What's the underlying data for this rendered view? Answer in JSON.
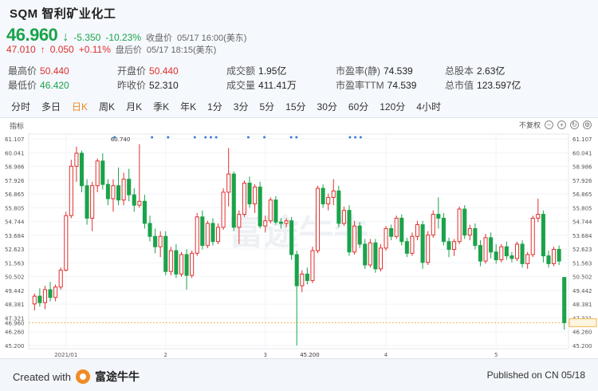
{
  "header": {
    "title": "SQM 智利矿业化工",
    "price": "46.960",
    "change": "-5.350",
    "change_pct": "-10.23%",
    "close_label": "收盘价",
    "close_time": "05/17 16:00(美东)",
    "ah_price": "47.010",
    "ah_change": "0.050",
    "ah_change_pct": "+0.11%",
    "ah_label": "盘后价",
    "ah_time": "05/17 18:15(美东)"
  },
  "stats": [
    [
      {
        "label": "最高价",
        "value": "50.440",
        "color": "red"
      },
      {
        "label": "开盘价",
        "value": "50.440",
        "color": "red"
      },
      {
        "label": "成交额",
        "value": "1.95亿",
        "color": "dark"
      },
      {
        "label": "市盈率(静)",
        "value": "74.539",
        "color": "dark"
      },
      {
        "label": "总股本",
        "value": "2.63亿",
        "color": "dark"
      }
    ],
    [
      {
        "label": "最低价",
        "value": "46.420",
        "color": "green"
      },
      {
        "label": "昨收价",
        "value": "52.310",
        "color": "dark"
      },
      {
        "label": "成交量",
        "value": "411.41万",
        "color": "dark"
      },
      {
        "label": "市盈率TTM",
        "value": "74.539",
        "color": "dark"
      },
      {
        "label": "总市值",
        "value": "123.597亿",
        "color": "dark"
      }
    ]
  ],
  "tabs": [
    "分时",
    "多日",
    "日K",
    "周K",
    "月K",
    "季K",
    "年K",
    "1分",
    "3分",
    "5分",
    "15分",
    "30分",
    "60分",
    "120分",
    "4小时"
  ],
  "active_tab": 2,
  "toolbar": {
    "indicator_label": "指标",
    "adjust_label": "不复权"
  },
  "watermark": "富途牛牛",
  "footer": {
    "created_with": "Created with",
    "brand": "富途牛牛",
    "published": "Published on CN 05/18"
  },
  "colors": {
    "up": "#e0302e",
    "down": "#1aa34a",
    "accent": "#f08a24"
  },
  "chart_data": {
    "type": "candlestick",
    "y_ticks": [
      "61.107",
      "60.041",
      "58.986",
      "57.926",
      "56.865",
      "55.805",
      "54.744",
      "53.684",
      "52.623",
      "51.563",
      "50.502",
      "49.442",
      "48.381",
      "47.321",
      "46.960",
      "46.260",
      "45.200"
    ],
    "ylim": [
      45.2,
      61.107
    ],
    "x_labels": [
      {
        "i": 6,
        "label": "2021/01"
      },
      {
        "i": 25,
        "label": "2"
      },
      {
        "i": 44,
        "label": "3"
      },
      {
        "i": 67,
        "label": "4"
      },
      {
        "i": 88,
        "label": "5"
      }
    ],
    "last_price": 46.96,
    "annotations": [
      {
        "i": 20,
        "value": 60.74,
        "label": "60.740"
      },
      {
        "i": 50,
        "value": 45.2,
        "label": "45.200"
      }
    ],
    "candles": [
      {
        "o": 48.4,
        "h": 49.2,
        "l": 47.9,
        "c": 49.0
      },
      {
        "o": 49.0,
        "h": 49.6,
        "l": 48.2,
        "c": 48.5
      },
      {
        "o": 48.5,
        "h": 49.8,
        "l": 48.0,
        "c": 49.5
      },
      {
        "o": 49.5,
        "h": 50.1,
        "l": 48.6,
        "c": 48.9
      },
      {
        "o": 48.9,
        "h": 49.9,
        "l": 48.6,
        "c": 49.7
      },
      {
        "o": 49.7,
        "h": 51.2,
        "l": 49.5,
        "c": 51.0
      },
      {
        "o": 51.0,
        "h": 55.5,
        "l": 50.9,
        "c": 55.2
      },
      {
        "o": 55.2,
        "h": 59.5,
        "l": 55.0,
        "c": 59.0
      },
      {
        "o": 59.0,
        "h": 60.5,
        "l": 57.8,
        "c": 60.0
      },
      {
        "o": 60.0,
        "h": 60.2,
        "l": 57.0,
        "c": 57.5
      },
      {
        "o": 57.5,
        "h": 58.0,
        "l": 54.5,
        "c": 55.0
      },
      {
        "o": 55.0,
        "h": 57.8,
        "l": 54.0,
        "c": 57.5
      },
      {
        "o": 57.5,
        "h": 59.6,
        "l": 57.0,
        "c": 59.4
      },
      {
        "o": 59.4,
        "h": 60.0,
        "l": 57.2,
        "c": 57.6
      },
      {
        "o": 57.6,
        "h": 58.0,
        "l": 56.0,
        "c": 56.5
      },
      {
        "o": 56.5,
        "h": 58.0,
        "l": 55.5,
        "c": 57.5
      },
      {
        "o": 57.5,
        "h": 58.9,
        "l": 56.0,
        "c": 56.4
      },
      {
        "o": 56.4,
        "h": 58.5,
        "l": 56.0,
        "c": 58.0
      },
      {
        "o": 58.0,
        "h": 58.8,
        "l": 56.3,
        "c": 56.8
      },
      {
        "o": 56.8,
        "h": 57.3,
        "l": 55.5,
        "c": 56.0
      },
      {
        "o": 56.0,
        "h": 60.7,
        "l": 55.8,
        "c": 56.3
      },
      {
        "o": 56.3,
        "h": 56.8,
        "l": 54.2,
        "c": 54.6
      },
      {
        "o": 54.6,
        "h": 55.2,
        "l": 53.2,
        "c": 53.6
      },
      {
        "o": 53.6,
        "h": 54.2,
        "l": 52.3,
        "c": 52.8
      },
      {
        "o": 52.8,
        "h": 54.0,
        "l": 52.0,
        "c": 53.6
      },
      {
        "o": 53.6,
        "h": 54.0,
        "l": 50.6,
        "c": 50.9
      },
      {
        "o": 50.9,
        "h": 52.8,
        "l": 50.6,
        "c": 52.5
      },
      {
        "o": 52.5,
        "h": 53.0,
        "l": 50.4,
        "c": 50.7
      },
      {
        "o": 50.7,
        "h": 52.4,
        "l": 50.5,
        "c": 52.2
      },
      {
        "o": 52.2,
        "h": 52.6,
        "l": 49.5,
        "c": 50.6
      },
      {
        "o": 50.6,
        "h": 52.5,
        "l": 50.4,
        "c": 52.3
      },
      {
        "o": 52.3,
        "h": 55.4,
        "l": 52.1,
        "c": 55.1
      },
      {
        "o": 55.1,
        "h": 55.6,
        "l": 52.6,
        "c": 52.9
      },
      {
        "o": 52.9,
        "h": 54.8,
        "l": 52.7,
        "c": 54.6
      },
      {
        "o": 54.6,
        "h": 55.0,
        "l": 52.9,
        "c": 53.2
      },
      {
        "o": 53.2,
        "h": 54.6,
        "l": 53.0,
        "c": 54.3
      },
      {
        "o": 54.3,
        "h": 57.3,
        "l": 54.1,
        "c": 57.0
      },
      {
        "o": 57.0,
        "h": 60.4,
        "l": 55.9,
        "c": 58.4
      },
      {
        "o": 58.4,
        "h": 58.6,
        "l": 54.0,
        "c": 54.3
      },
      {
        "o": 54.3,
        "h": 55.6,
        "l": 53.0,
        "c": 55.3
      },
      {
        "o": 55.3,
        "h": 57.9,
        "l": 55.1,
        "c": 57.7
      },
      {
        "o": 57.7,
        "h": 58.2,
        "l": 55.8,
        "c": 56.1
      },
      {
        "o": 56.1,
        "h": 57.6,
        "l": 55.4,
        "c": 57.4
      },
      {
        "o": 57.4,
        "h": 57.8,
        "l": 54.2,
        "c": 54.4
      },
      {
        "o": 54.4,
        "h": 55.2,
        "l": 53.9,
        "c": 54.8
      },
      {
        "o": 54.8,
        "h": 56.6,
        "l": 54.6,
        "c": 56.4
      },
      {
        "o": 56.4,
        "h": 56.7,
        "l": 54.5,
        "c": 54.7
      },
      {
        "o": 54.7,
        "h": 55.0,
        "l": 54.2,
        "c": 54.6
      },
      {
        "o": 54.6,
        "h": 55.0,
        "l": 54.3,
        "c": 54.8
      },
      {
        "o": 54.8,
        "h": 55.1,
        "l": 51.8,
        "c": 52.2
      },
      {
        "o": 52.2,
        "h": 52.5,
        "l": 45.2,
        "c": 49.8
      },
      {
        "o": 49.8,
        "h": 51.0,
        "l": 49.3,
        "c": 50.7
      },
      {
        "o": 50.7,
        "h": 51.2,
        "l": 49.9,
        "c": 50.2
      },
      {
        "o": 50.2,
        "h": 52.8,
        "l": 50.0,
        "c": 52.5
      },
      {
        "o": 52.5,
        "h": 57.5,
        "l": 52.3,
        "c": 57.3
      },
      {
        "o": 57.3,
        "h": 57.6,
        "l": 55.8,
        "c": 56.1
      },
      {
        "o": 56.1,
        "h": 56.9,
        "l": 55.6,
        "c": 56.6
      },
      {
        "o": 56.6,
        "h": 58.0,
        "l": 56.0,
        "c": 57.1
      },
      {
        "o": 57.1,
        "h": 57.5,
        "l": 54.3,
        "c": 54.6
      },
      {
        "o": 54.6,
        "h": 55.9,
        "l": 54.4,
        "c": 55.6
      },
      {
        "o": 55.6,
        "h": 56.0,
        "l": 52.1,
        "c": 52.4
      },
      {
        "o": 52.4,
        "h": 54.8,
        "l": 52.2,
        "c": 54.4
      },
      {
        "o": 54.4,
        "h": 54.7,
        "l": 52.7,
        "c": 53.0
      },
      {
        "o": 53.0,
        "h": 53.4,
        "l": 51.1,
        "c": 51.4
      },
      {
        "o": 51.4,
        "h": 53.4,
        "l": 51.2,
        "c": 53.1
      },
      {
        "o": 53.1,
        "h": 53.4,
        "l": 50.8,
        "c": 51.1
      },
      {
        "o": 51.1,
        "h": 53.0,
        "l": 50.9,
        "c": 52.7
      },
      {
        "o": 52.7,
        "h": 54.4,
        "l": 52.5,
        "c": 54.2
      },
      {
        "o": 54.2,
        "h": 54.5,
        "l": 53.3,
        "c": 53.6
      },
      {
        "o": 53.6,
        "h": 55.2,
        "l": 53.4,
        "c": 55.0
      },
      {
        "o": 55.0,
        "h": 55.3,
        "l": 52.9,
        "c": 53.2
      },
      {
        "o": 53.2,
        "h": 53.5,
        "l": 52.0,
        "c": 52.3
      },
      {
        "o": 52.3,
        "h": 53.9,
        "l": 52.1,
        "c": 53.6
      },
      {
        "o": 53.6,
        "h": 54.8,
        "l": 53.3,
        "c": 54.5
      },
      {
        "o": 54.5,
        "h": 54.8,
        "l": 51.1,
        "c": 51.6
      },
      {
        "o": 51.6,
        "h": 54.0,
        "l": 51.4,
        "c": 53.7
      },
      {
        "o": 53.7,
        "h": 55.6,
        "l": 53.5,
        "c": 55.3
      },
      {
        "o": 55.3,
        "h": 56.6,
        "l": 54.2,
        "c": 55.0
      },
      {
        "o": 55.0,
        "h": 55.4,
        "l": 52.9,
        "c": 53.2
      },
      {
        "o": 53.2,
        "h": 53.5,
        "l": 52.0,
        "c": 52.6
      },
      {
        "o": 52.6,
        "h": 53.4,
        "l": 52.1,
        "c": 53.2
      },
      {
        "o": 53.2,
        "h": 55.9,
        "l": 53.0,
        "c": 55.7
      },
      {
        "o": 55.7,
        "h": 56.0,
        "l": 53.4,
        "c": 53.7
      },
      {
        "o": 53.7,
        "h": 54.5,
        "l": 53.3,
        "c": 54.2
      },
      {
        "o": 54.2,
        "h": 54.6,
        "l": 52.6,
        "c": 52.9
      },
      {
        "o": 52.9,
        "h": 53.3,
        "l": 51.3,
        "c": 51.7
      },
      {
        "o": 51.7,
        "h": 53.8,
        "l": 51.5,
        "c": 53.5
      },
      {
        "o": 53.5,
        "h": 53.9,
        "l": 51.9,
        "c": 52.4
      },
      {
        "o": 52.4,
        "h": 53.0,
        "l": 51.5,
        "c": 51.8
      },
      {
        "o": 51.8,
        "h": 53.0,
        "l": 51.6,
        "c": 52.8
      },
      {
        "o": 52.8,
        "h": 53.2,
        "l": 51.8,
        "c": 52.1
      },
      {
        "o": 52.1,
        "h": 52.4,
        "l": 51.6,
        "c": 51.9
      },
      {
        "o": 51.9,
        "h": 53.2,
        "l": 51.7,
        "c": 53.0
      },
      {
        "o": 53.0,
        "h": 53.3,
        "l": 51.2,
        "c": 51.5
      },
      {
        "o": 51.5,
        "h": 52.4,
        "l": 51.1,
        "c": 52.2
      },
      {
        "o": 52.2,
        "h": 55.2,
        "l": 52.0,
        "c": 55.0
      },
      {
        "o": 55.0,
        "h": 56.5,
        "l": 54.7,
        "c": 55.3
      },
      {
        "o": 55.3,
        "h": 55.6,
        "l": 51.6,
        "c": 52.1
      },
      {
        "o": 52.1,
        "h": 52.5,
        "l": 51.2,
        "c": 51.5
      },
      {
        "o": 51.5,
        "h": 52.8,
        "l": 51.3,
        "c": 52.6
      },
      {
        "o": 52.6,
        "h": 52.9,
        "l": 51.4,
        "c": 51.7
      },
      {
        "o": 50.44,
        "h": 50.44,
        "l": 46.42,
        "c": 46.96
      }
    ]
  }
}
